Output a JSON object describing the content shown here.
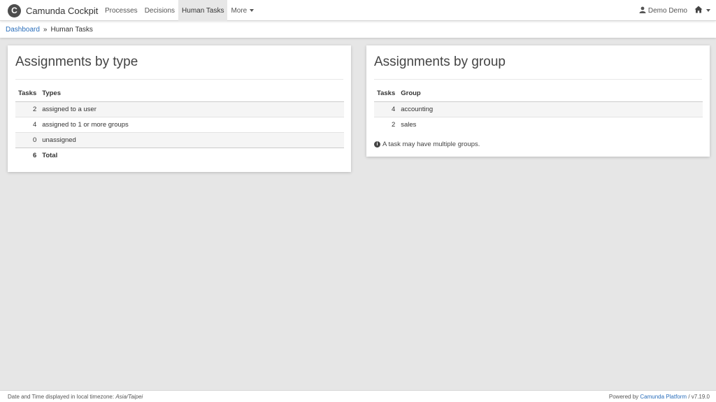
{
  "app": {
    "title": "Camunda Cockpit",
    "logo_letter": "C"
  },
  "nav": {
    "items": [
      {
        "label": "Processes"
      },
      {
        "label": "Decisions"
      },
      {
        "label": "Human Tasks"
      },
      {
        "label": "More"
      }
    ],
    "active": "Human Tasks",
    "user_label": "Demo Demo"
  },
  "breadcrumb": {
    "home_label": "Dashboard",
    "separator": "»",
    "current": "Human Tasks"
  },
  "assignments_by_type": {
    "title": "Assignments by type",
    "headers": {
      "tasks": "Tasks",
      "types": "Types"
    },
    "rows": [
      {
        "count": "2",
        "label": "assigned to a user"
      },
      {
        "count": "4",
        "label": "assigned to 1 or more groups"
      },
      {
        "count": "0",
        "label": "unassigned"
      }
    ],
    "total": {
      "count": "6",
      "label": "Total"
    }
  },
  "assignments_by_group": {
    "title": "Assignments by group",
    "headers": {
      "tasks": "Tasks",
      "group": "Group"
    },
    "rows": [
      {
        "count": "4",
        "label": "accounting"
      },
      {
        "count": "2",
        "label": "sales"
      }
    ],
    "note": "A task may have multiple groups."
  },
  "footer": {
    "tz_prefix": "Date and Time displayed in local timezone:",
    "tz_value": "Asia/Taipei",
    "powered_prefix": "Powered by",
    "powered_link": "Camunda Platform",
    "version": "/ v7.19.0"
  },
  "colors": {
    "link": "#2a6ebb",
    "background": "#e6e6e6",
    "active_nav": "#e7e7e7"
  }
}
